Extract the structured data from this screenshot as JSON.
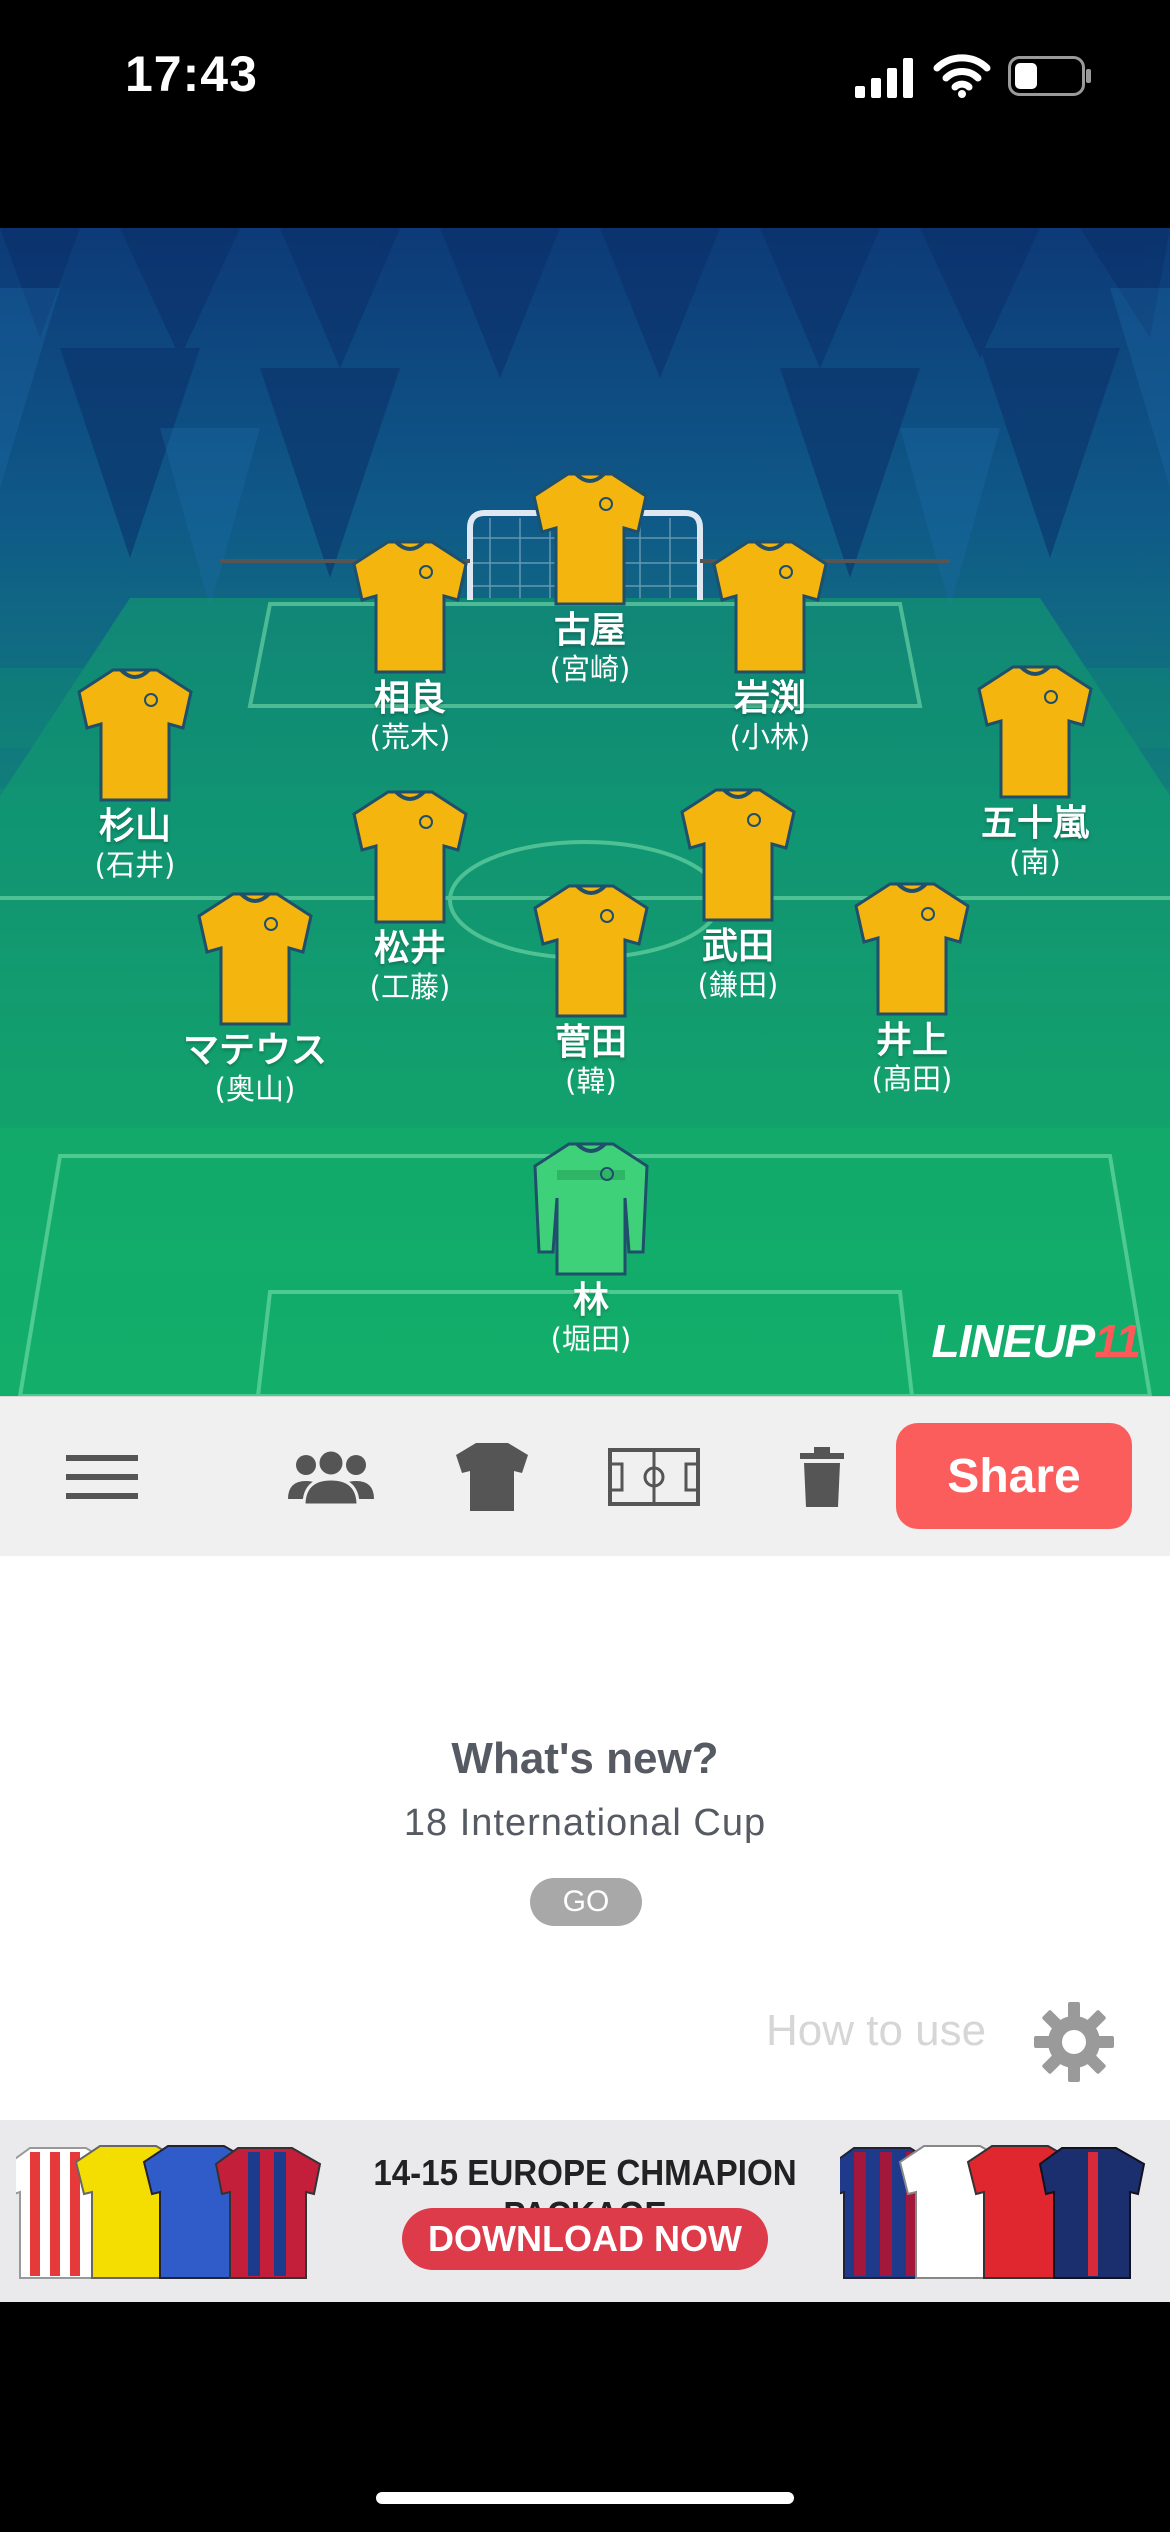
{
  "status_bar": {
    "time": "17:43"
  },
  "lineup": {
    "players": [
      {
        "name": "古屋",
        "sub": "(宮崎)",
        "kit": "outfield"
      },
      {
        "name": "相良",
        "sub": "(荒木)",
        "kit": "outfield"
      },
      {
        "name": "岩渕",
        "sub": "(小林)",
        "kit": "outfield"
      },
      {
        "name": "杉山",
        "sub": "(石井)",
        "kit": "outfield"
      },
      {
        "name": "五十嵐",
        "sub": "(南)",
        "kit": "outfield"
      },
      {
        "name": "松井",
        "sub": "(工藤)",
        "kit": "outfield"
      },
      {
        "name": "武田",
        "sub": "(鎌田)",
        "kit": "outfield"
      },
      {
        "name": "マテウス",
        "sub": "(奥山)",
        "kit": "outfield"
      },
      {
        "name": "菅田",
        "sub": "(韓)",
        "kit": "outfield"
      },
      {
        "name": "井上",
        "sub": "(髙田)",
        "kit": "outfield"
      },
      {
        "name": "林",
        "sub": "(堀田)",
        "kit": "goalkeeper"
      }
    ],
    "outfield_kit_color": "#f5b50f",
    "goalkeeper_kit_color": "#3ed17a",
    "brand_main": "LINEUP",
    "brand_accent": "11"
  },
  "toolbar": {
    "icons": [
      "menu-icon",
      "team-icon",
      "shirt-icon",
      "pitch-icon",
      "trash-icon"
    ],
    "share_label": "Share",
    "share_color": "#fb5d5d"
  },
  "news": {
    "title": "What's new?",
    "subtitle": "18 International Cup",
    "go_label": "GO"
  },
  "help": {
    "label": "How to use"
  },
  "banner": {
    "title": "14-15 EUROPE CHMAPION PACKAGE",
    "button_label": "DOWNLOAD NOW",
    "button_color": "#dd3a4a"
  }
}
